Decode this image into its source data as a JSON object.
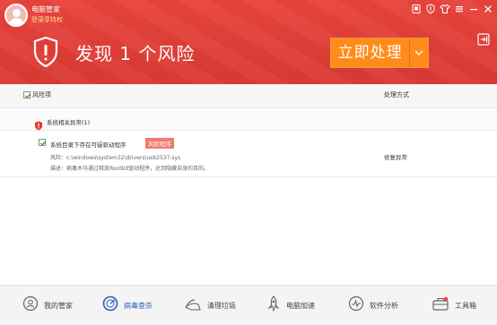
{
  "header": {
    "app_title": "电脑管家",
    "login_link": "登录享特权",
    "risk_title": "发现 1 个风险",
    "fix_button": "立即处理",
    "window_controls": [
      "skin-icon",
      "shield-protect-icon",
      "shirt-icon",
      "menu-icon",
      "minimize-icon",
      "close-icon"
    ],
    "bg_color": "#e3403a",
    "button_color": "#ff8c1a"
  },
  "table": {
    "col_risk": "风险项",
    "col_action": "处理方式",
    "group_label": "系统相关异常(1)",
    "items": [
      {
        "title": "系统目录下存在可疑驱动程序",
        "tag": "风险程序",
        "path": "风险：c:\\windows\\system32\\drivers\\usb2537.sys",
        "desc": "描述：病毒木马通过释放Rootkit驱动程序，达到隐藏自身的目的。",
        "action": "修复异常"
      }
    ]
  },
  "bottom_nav": [
    {
      "label": "我的管家",
      "icon": "butler-icon"
    },
    {
      "label": "病毒查杀",
      "icon": "virus-scan-icon",
      "active": true
    },
    {
      "label": "清理垃圾",
      "icon": "broom-icon"
    },
    {
      "label": "电脑加速",
      "icon": "rocket-icon"
    },
    {
      "label": "软件分析",
      "icon": "software-analysis-icon"
    },
    {
      "label": "工具箱",
      "icon": "toolbox-icon"
    }
  ]
}
